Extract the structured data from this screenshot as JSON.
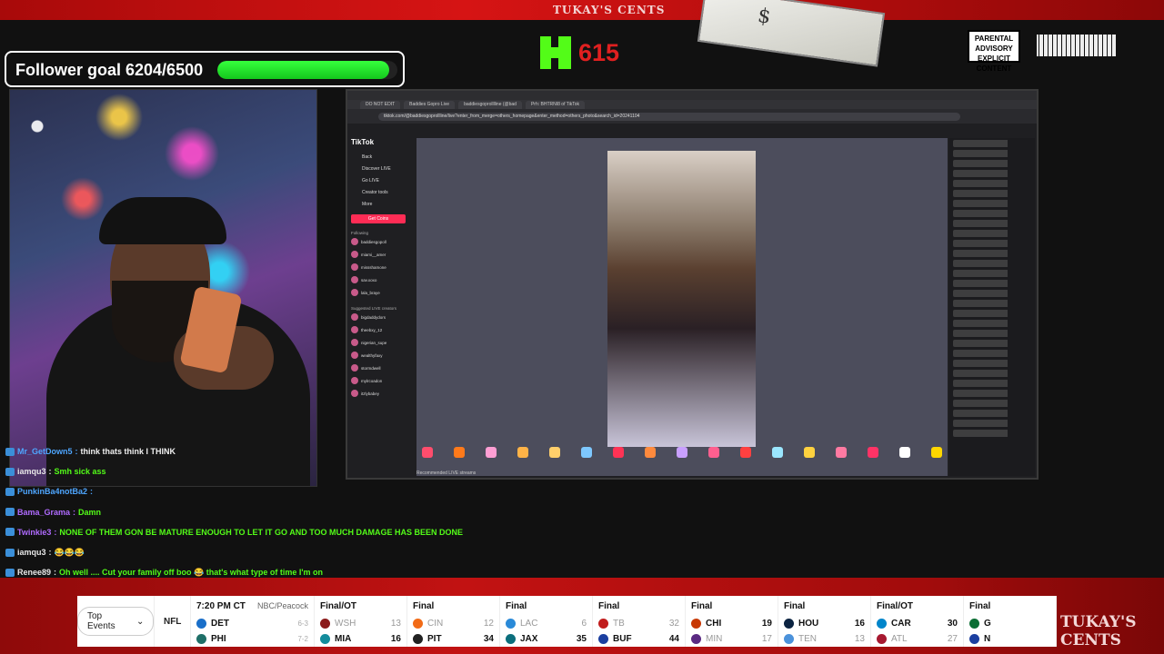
{
  "top": {
    "brand": "TUKAY'S CENTS",
    "kick_count": "615",
    "advisory": "PARENTAL ADVISORY EXPLICIT CONTENT"
  },
  "goal": {
    "text": "Follower goal 6204/6500",
    "current": 6204,
    "target": 6500
  },
  "browser": {
    "url": "tiktok.com/@baddiesgoprollline/live?enter_from_merge=others_homepage&enter_method=others_photo&search_id=20241104",
    "tabs": [
      "DO NOT EDIT",
      "Baddies Gopro Live",
      "baddiesgoprolllline (@bad",
      "Prh: BHTRNI8 of TikTok"
    ],
    "tiktok": {
      "logo": "TikTok",
      "nav": [
        "Back",
        "Discover LIVE",
        "Go LIVE",
        "Creator tools",
        "More"
      ],
      "button": "Get Coins",
      "following_label": "Following",
      "following": [
        "baddiesgopoll",
        "miami__amer",
        "missshamone",
        "sav.xoxo",
        "lala_braye"
      ],
      "suggested_label": "Suggested LIVE creators",
      "suggested": [
        "bigdaddydors",
        "theebxy_12",
        "nigerian_supe",
        "wealthyfaxy",
        "stormdwell",
        "mylrcoadon",
        "itzlybabey"
      ],
      "recommended": "Recommended LIVE streams"
    }
  },
  "chat": [
    {
      "user": "Mr_GetDown5",
      "text": "think thats think I THINK",
      "user_class": "u-blue",
      "text_class": "txt-white"
    },
    {
      "user": "iamqu3",
      "text": "Smh sick ass",
      "user_class": "u-white",
      "text_class": "txt-green"
    },
    {
      "user": "PunkinBa4notBa2",
      "text": "",
      "user_class": "u-blue",
      "text_class": "txt-green"
    },
    {
      "user": "Bama_Grama",
      "text": "Damn",
      "user_class": "u-purple",
      "text_class": "txt-green"
    },
    {
      "user": "Twinkie3",
      "text": "NONE OF THEM GON BE MATURE ENOUGH TO LET IT GO AND TOO MUCH DAMAGE HAS BEEN DONE",
      "user_class": "u-purple",
      "text_class": "txt-green"
    },
    {
      "user": "iamqu3",
      "text": "😂😂😂",
      "user_class": "u-white",
      "text_class": "txt-green"
    },
    {
      "user": "Renee89",
      "text": "Oh well .... Cut your family off boo 😂 that's what type of time I'm on",
      "user_class": "u-white",
      "text_class": "txt-green"
    }
  ],
  "scores": {
    "top_events_label": "Top Events",
    "league": "NFL",
    "games": [
      {
        "status": "7:20 PM CT",
        "network": "NBC/Peacock",
        "away": "DET",
        "away_score": "6-3",
        "home": "PHI",
        "home_score": "7-2",
        "away_color": "#1a6fc9",
        "home_color": "#1f6f68",
        "winner": "none",
        "wide": true
      },
      {
        "status": "Final/OT",
        "network": "",
        "away": "WSH",
        "away_score": "13",
        "home": "MIA",
        "home_score": "16",
        "away_color": "#8b1a1a",
        "home_color": "#138c9c",
        "winner": "home",
        "wide": false
      },
      {
        "status": "Final",
        "network": "",
        "away": "CIN",
        "away_score": "12",
        "home": "PIT",
        "home_score": "34",
        "away_color": "#f26b16",
        "home_color": "#222222",
        "winner": "home",
        "wide": false
      },
      {
        "status": "Final",
        "network": "",
        "away": "LAC",
        "away_score": "6",
        "home": "JAX",
        "home_score": "35",
        "away_color": "#2a8ad8",
        "home_color": "#0b6e7c",
        "winner": "home",
        "wide": false
      },
      {
        "status": "Final",
        "network": "",
        "away": "TB",
        "away_score": "32",
        "home": "BUF",
        "home_score": "44",
        "away_color": "#c11c1c",
        "home_color": "#1b3fa0",
        "winner": "home",
        "wide": false
      },
      {
        "status": "Final",
        "network": "",
        "away": "CHI",
        "away_score": "19",
        "home": "MIN",
        "home_score": "17",
        "away_color": "#c83803",
        "home_color": "#5a2a82",
        "winner": "away",
        "wide": false
      },
      {
        "status": "Final",
        "network": "",
        "away": "HOU",
        "away_score": "16",
        "home": "TEN",
        "home_score": "13",
        "away_color": "#0b2341",
        "home_color": "#4b92db",
        "winner": "away",
        "wide": false
      },
      {
        "status": "Final/OT",
        "network": "",
        "away": "CAR",
        "away_score": "30",
        "home": "ATL",
        "home_score": "27",
        "away_color": "#0085ca",
        "home_color": "#a71930",
        "winner": "away",
        "wide": false
      },
      {
        "status": "Final",
        "network": "",
        "away": "G",
        "away_score": "",
        "home": "N",
        "home_score": "",
        "away_color": "#0b6e34",
        "home_color": "#1b3fa0",
        "winner": "none",
        "wide": false
      }
    ]
  },
  "bottom_brand": "TUKAY'S CENTS"
}
